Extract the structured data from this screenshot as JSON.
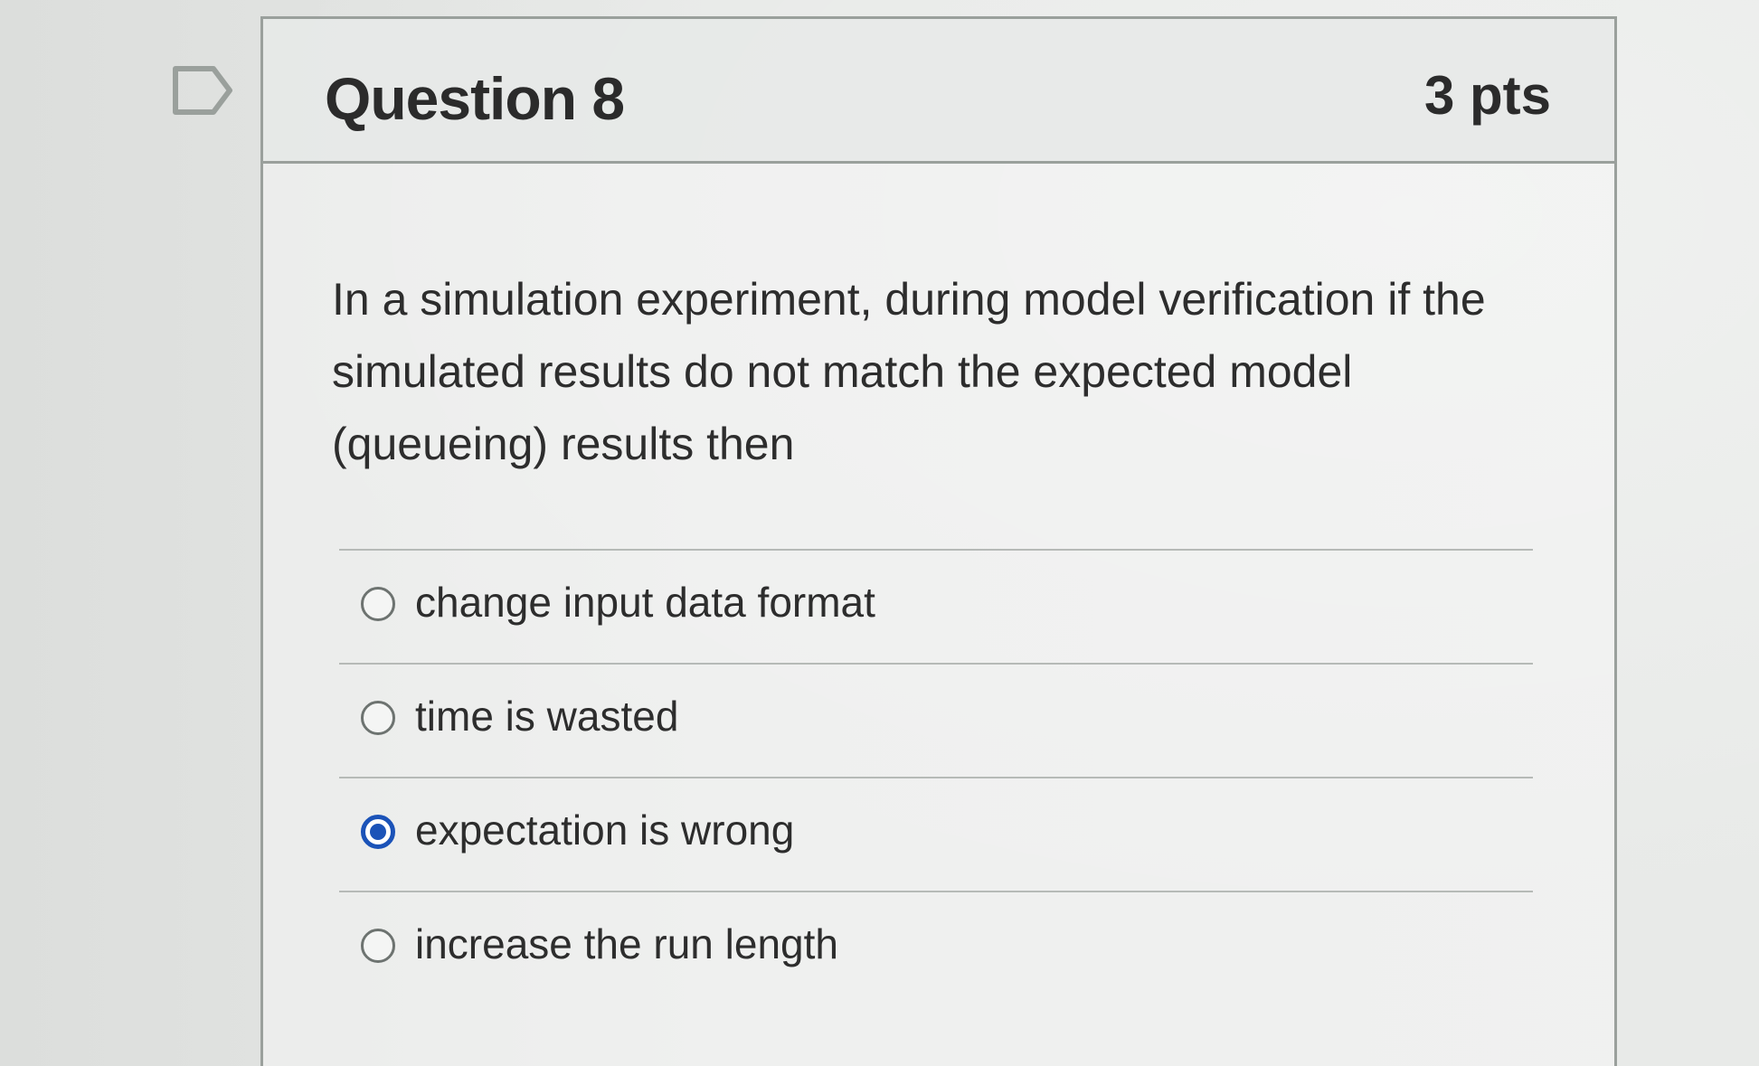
{
  "question": {
    "title": "Question 8",
    "points": "3 pts",
    "text": "In a simulation experiment, during model verification if the simulated results do not match the expected model (queueing) results then"
  },
  "answers": [
    {
      "label": "change input data format",
      "selected": false
    },
    {
      "label": "time is wasted",
      "selected": false
    },
    {
      "label": "expectation is wrong",
      "selected": true
    },
    {
      "label": "increase the run length",
      "selected": false
    }
  ],
  "colors": {
    "selected_radio": "#1b53b8",
    "border": "#9aa09c"
  },
  "icons": {
    "flag": "flag-icon"
  }
}
